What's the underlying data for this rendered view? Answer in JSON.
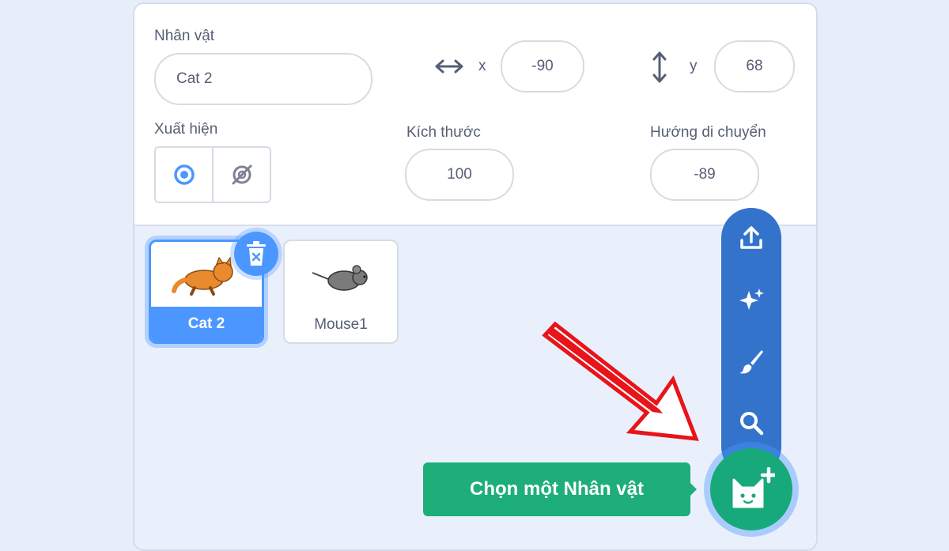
{
  "sprite_info": {
    "name_label": "Nhân vật",
    "name_value": "Cat 2",
    "x_label": "x",
    "x_value": "-90",
    "y_label": "y",
    "y_value": "68",
    "show_label": "Xuất hiện",
    "size_label": "Kích thước",
    "size_value": "100",
    "direction_label": "Hướng di chuyển",
    "direction_value": "-89"
  },
  "sprites": [
    {
      "name": "Cat 2",
      "selected": true
    },
    {
      "name": "Mouse1",
      "selected": false
    }
  ],
  "sprite_menu": {
    "items": [
      "upload-icon",
      "surprise-icon",
      "paint-icon",
      "search-icon"
    ],
    "main_button_icon": "cat-plus-icon",
    "tooltip": "Chọn một Nhân vật"
  },
  "colors": {
    "accent_blue": "#4c97ff",
    "menu_blue": "#3373cc",
    "green": "#1dae79",
    "arrow_red": "#e8141a"
  }
}
